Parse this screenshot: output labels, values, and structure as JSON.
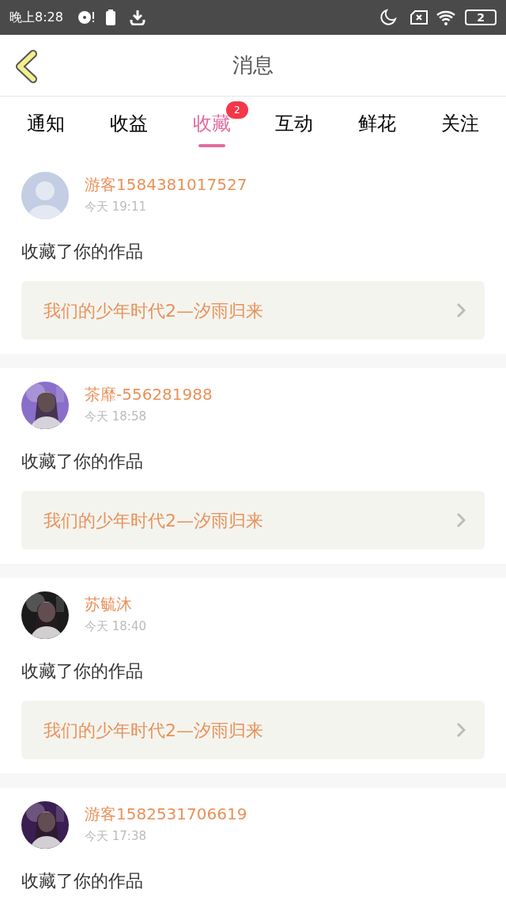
{
  "status_bar": {
    "time": "晚上8:28",
    "battery": "2"
  },
  "header": {
    "title": "消息"
  },
  "tabs": [
    {
      "label": "通知",
      "selected": false
    },
    {
      "label": "收益",
      "selected": false
    },
    {
      "label": "收藏",
      "selected": true,
      "badge": "2"
    },
    {
      "label": "互动",
      "selected": false
    },
    {
      "label": "鲜花",
      "selected": false
    },
    {
      "label": "关注",
      "selected": false
    }
  ],
  "messages": [
    {
      "avatar": {
        "kind": "default"
      },
      "name": "游客1584381017527",
      "time": "今天 19:11",
      "text": "收藏了你的作品",
      "work": "我们的少年时代2—汐雨归来"
    },
    {
      "name": "茶靡-556281988",
      "time": "今天 18:58",
      "text": "收藏了你的作品",
      "work": "我们的少年时代2—汐雨归来"
    },
    {
      "name": "苏毓沐",
      "time": "今天 18:40",
      "text": "收藏了你的作品",
      "work": "我们的少年时代2—汐雨归来"
    },
    {
      "name": "游客1582531706619",
      "time": "今天 17:38",
      "text": "收藏了你的作品"
    }
  ]
}
